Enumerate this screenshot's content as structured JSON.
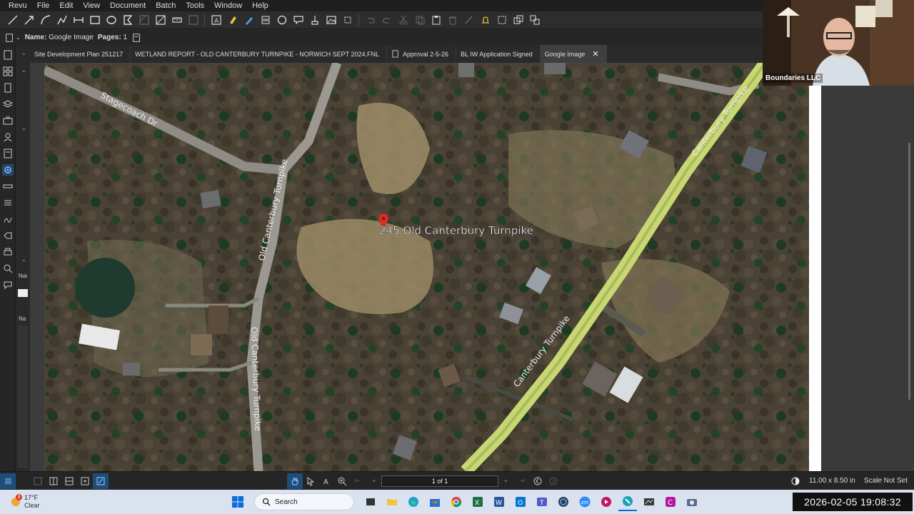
{
  "menubar": {
    "items": [
      "Revu",
      "File",
      "Edit",
      "View",
      "Document",
      "Batch",
      "Tools",
      "Window",
      "Help"
    ]
  },
  "propbar": {
    "name_label": "Name:",
    "name_value": "Google Image",
    "pages_label": "Pages:",
    "pages_value": "1"
  },
  "tabs": [
    {
      "label": "Site Development Plan 251217",
      "active": false
    },
    {
      "label": "WETLAND REPORT - OLD CANTERBURY TURNPIKE - NORWICH  SEPT 2024.FNL",
      "active": false
    },
    {
      "label": "Approval 2-5-26",
      "active": false
    },
    {
      "label": "BL IW Application Signed",
      "active": false
    },
    {
      "label": "Google Image",
      "active": true
    }
  ],
  "map": {
    "marker_label": "245 Old Canterbury Turnpike",
    "roads": {
      "stagecoach": "Stagecoach Dr",
      "old_canterbury_1": "Old Canterbury Turnpike",
      "old_canterbury_2": "Old Canterbury Turnpike",
      "canterbury_1": "Canterbury Turnpike",
      "canterbury_2": "Canterbury Turnpike"
    }
  },
  "left_panel": {
    "label_1": "Nai",
    "label_2": "Na"
  },
  "webcam": {
    "label": "Boundaries LLC"
  },
  "statusbar": {
    "page_indicator": "1 of 1",
    "page_size": "11.00 x 8.50 in",
    "scale": "Scale Not Set"
  },
  "taskbar": {
    "weather_temp": "17°F",
    "weather_cond": "Clear",
    "weather_badge": "3",
    "search_placeholder": "Search",
    "clock": "2026-02-05  19:08:32"
  },
  "colors": {
    "road_highlight": "#c7d873",
    "marker": "#d93025"
  }
}
